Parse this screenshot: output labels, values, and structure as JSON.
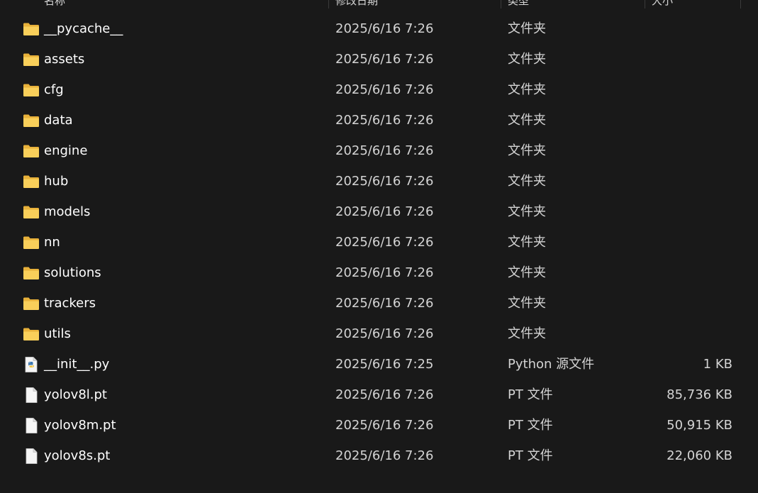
{
  "columns": {
    "name": "名称",
    "date": "修改日期",
    "type": "类型",
    "size": "大小"
  },
  "files": [
    {
      "name": "__pycache__",
      "date": "2025/6/16 7:26",
      "type": "文件夹",
      "size": "",
      "icon": "folder-icon"
    },
    {
      "name": "assets",
      "date": "2025/6/16 7:26",
      "type": "文件夹",
      "size": "",
      "icon": "folder-icon"
    },
    {
      "name": "cfg",
      "date": "2025/6/16 7:26",
      "type": "文件夹",
      "size": "",
      "icon": "folder-icon"
    },
    {
      "name": "data",
      "date": "2025/6/16 7:26",
      "type": "文件夹",
      "size": "",
      "icon": "folder-icon"
    },
    {
      "name": "engine",
      "date": "2025/6/16 7:26",
      "type": "文件夹",
      "size": "",
      "icon": "folder-icon"
    },
    {
      "name": "hub",
      "date": "2025/6/16 7:26",
      "type": "文件夹",
      "size": "",
      "icon": "folder-icon"
    },
    {
      "name": "models",
      "date": "2025/6/16 7:26",
      "type": "文件夹",
      "size": "",
      "icon": "folder-icon"
    },
    {
      "name": "nn",
      "date": "2025/6/16 7:26",
      "type": "文件夹",
      "size": "",
      "icon": "folder-icon"
    },
    {
      "name": "solutions",
      "date": "2025/6/16 7:26",
      "type": "文件夹",
      "size": "",
      "icon": "folder-icon"
    },
    {
      "name": "trackers",
      "date": "2025/6/16 7:26",
      "type": "文件夹",
      "size": "",
      "icon": "folder-icon"
    },
    {
      "name": "utils",
      "date": "2025/6/16 7:26",
      "type": "文件夹",
      "size": "",
      "icon": "folder-icon"
    },
    {
      "name": "__init__.py",
      "date": "2025/6/16 7:25",
      "type": "Python 源文件",
      "size": "1 KB",
      "icon": "python-file-icon"
    },
    {
      "name": "yolov8l.pt",
      "date": "2025/6/16 7:26",
      "type": "PT 文件",
      "size": "85,736 KB",
      "icon": "file-icon"
    },
    {
      "name": "yolov8m.pt",
      "date": "2025/6/16 7:26",
      "type": "PT 文件",
      "size": "50,915 KB",
      "icon": "file-icon"
    },
    {
      "name": "yolov8s.pt",
      "date": "2025/6/16 7:26",
      "type": "PT 文件",
      "size": "22,060 KB",
      "icon": "file-icon"
    }
  ],
  "colors": {
    "background": "#191919",
    "folder": "#f4c44e",
    "text": "#ffffff"
  }
}
